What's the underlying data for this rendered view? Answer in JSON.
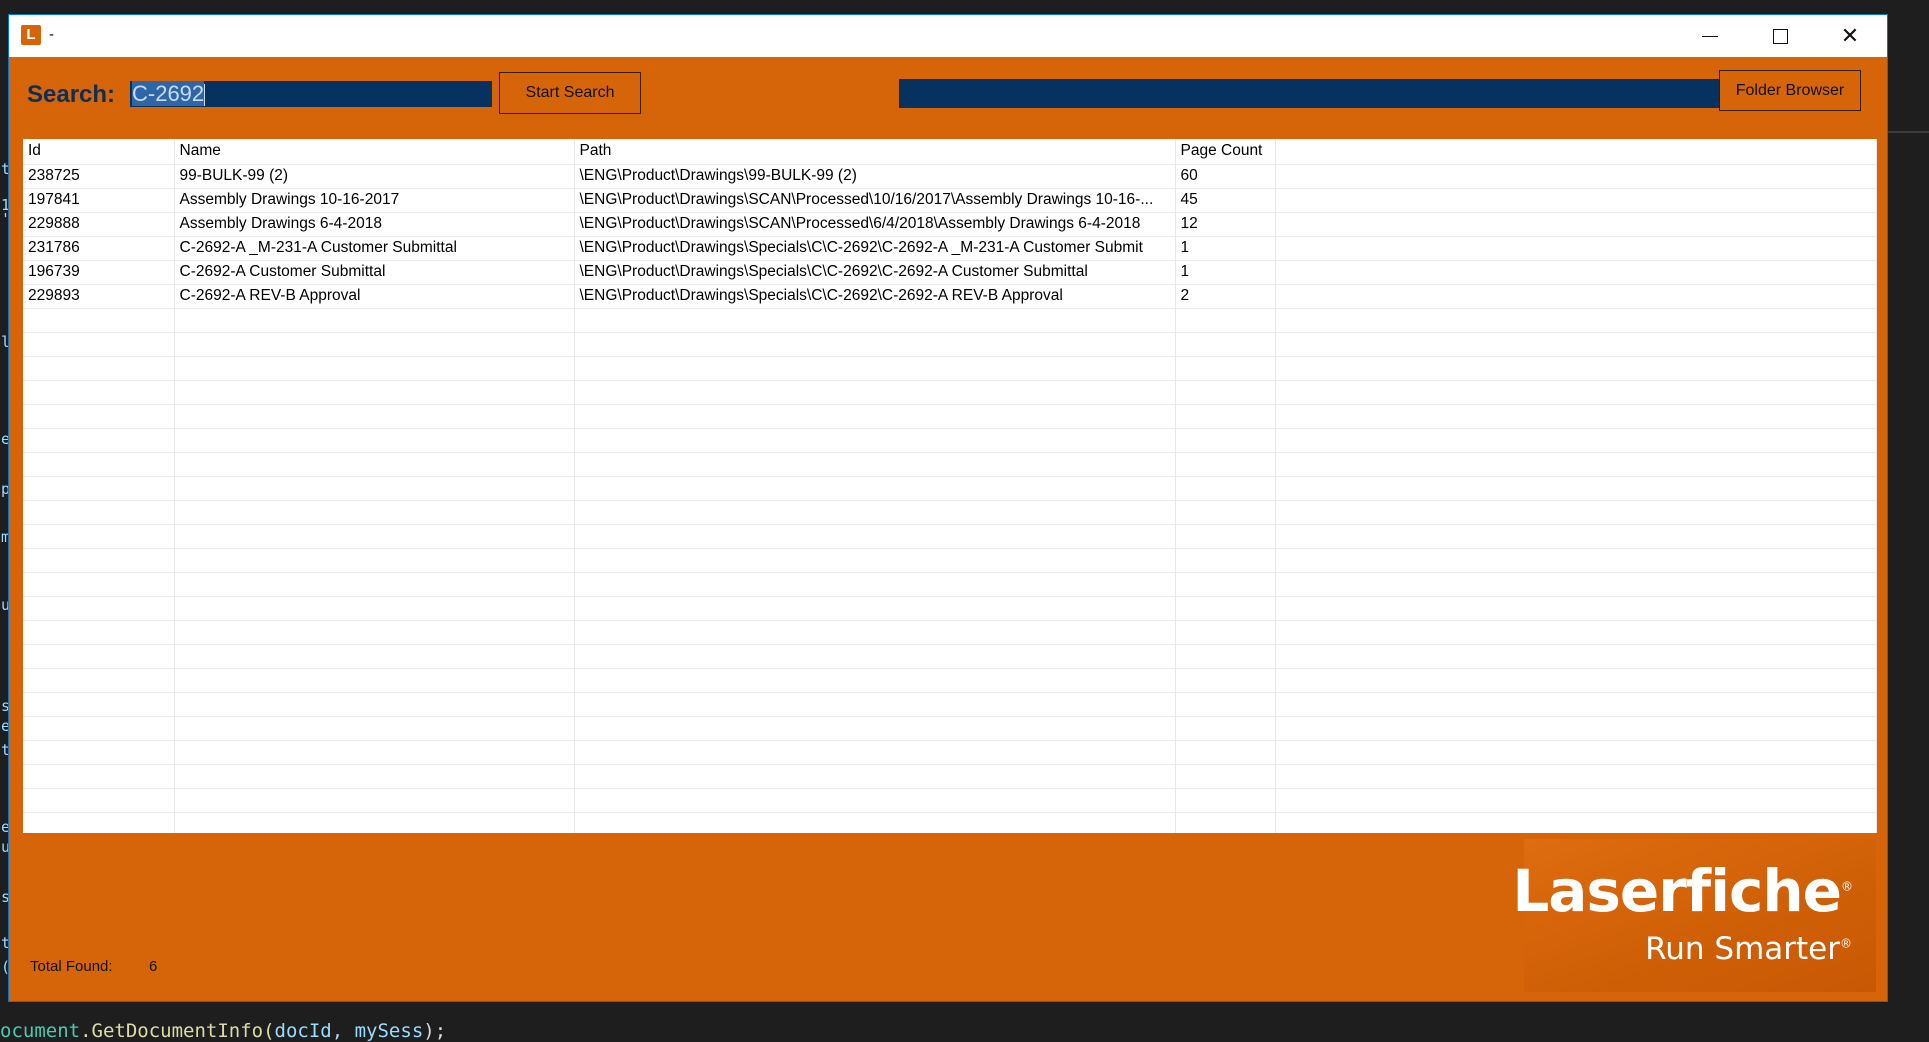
{
  "window": {
    "title": "-",
    "icon_letter": "L",
    "controls": {
      "minimize": "—",
      "maximize": "☐",
      "close": "✕"
    }
  },
  "toolbar": {
    "search_label": "Search:",
    "search_value": "C-2692",
    "start_search_label": "Start Search",
    "folder_browser_label": "Folder Browser",
    "path_value": ""
  },
  "table": {
    "columns": [
      "Id",
      "Name",
      "Path",
      "Page Count"
    ],
    "rows": [
      [
        "238725",
        "99-BULK-99 (2)",
        "\\ENG\\Product\\Drawings\\99-BULK-99 (2)",
        "60"
      ],
      [
        "197841",
        "Assembly Drawings 10-16-2017",
        "\\ENG\\Product\\Drawings\\SCAN\\Processed\\10/16/2017\\Assembly Drawings 10-16-...",
        "45"
      ],
      [
        "229888",
        "Assembly Drawings 6-4-2018",
        "\\ENG\\Product\\Drawings\\SCAN\\Processed\\6/4/2018\\Assembly Drawings 6-4-2018",
        "12"
      ],
      [
        "231786",
        "C-2692-A _M-231-A Customer Submittal",
        "\\ENG\\Product\\Drawings\\Specials\\C\\C-2692\\C-2692-A _M-231-A Customer Submit",
        "1"
      ],
      [
        "196739",
        "C-2692-A Customer Submittal",
        "\\ENG\\Product\\Drawings\\Specials\\C\\C-2692\\C-2692-A Customer Submittal",
        "1"
      ],
      [
        "229893",
        "C-2692-A REV-B Approval",
        "\\ENG\\Product\\Drawings\\Specials\\C\\C-2692\\C-2692-A REV-B Approval",
        "2"
      ]
    ]
  },
  "footer": {
    "total_label": "Total Found:",
    "total_value": "6"
  },
  "logo": {
    "name": "Laserfiche",
    "tagline": "Run Smarter",
    "registered": "®"
  },
  "editor": {
    "bottom_line_obj": "ocument",
    "bottom_line_method": ".GetDocumentInfo(",
    "bottom_line_args": "docId, mySess",
    "bottom_line_end": ");",
    "gutter_chars": [
      "t",
      "1",
      "'",
      "l",
      "e",
      "p",
      "m",
      "u",
      "s",
      "e",
      "t",
      "e",
      "u",
      "s",
      "t",
      "("
    ]
  },
  "colors": {
    "window_bg": "#d6650a",
    "input_bg": "#06325f",
    "label_color": "#0b2f5a"
  }
}
